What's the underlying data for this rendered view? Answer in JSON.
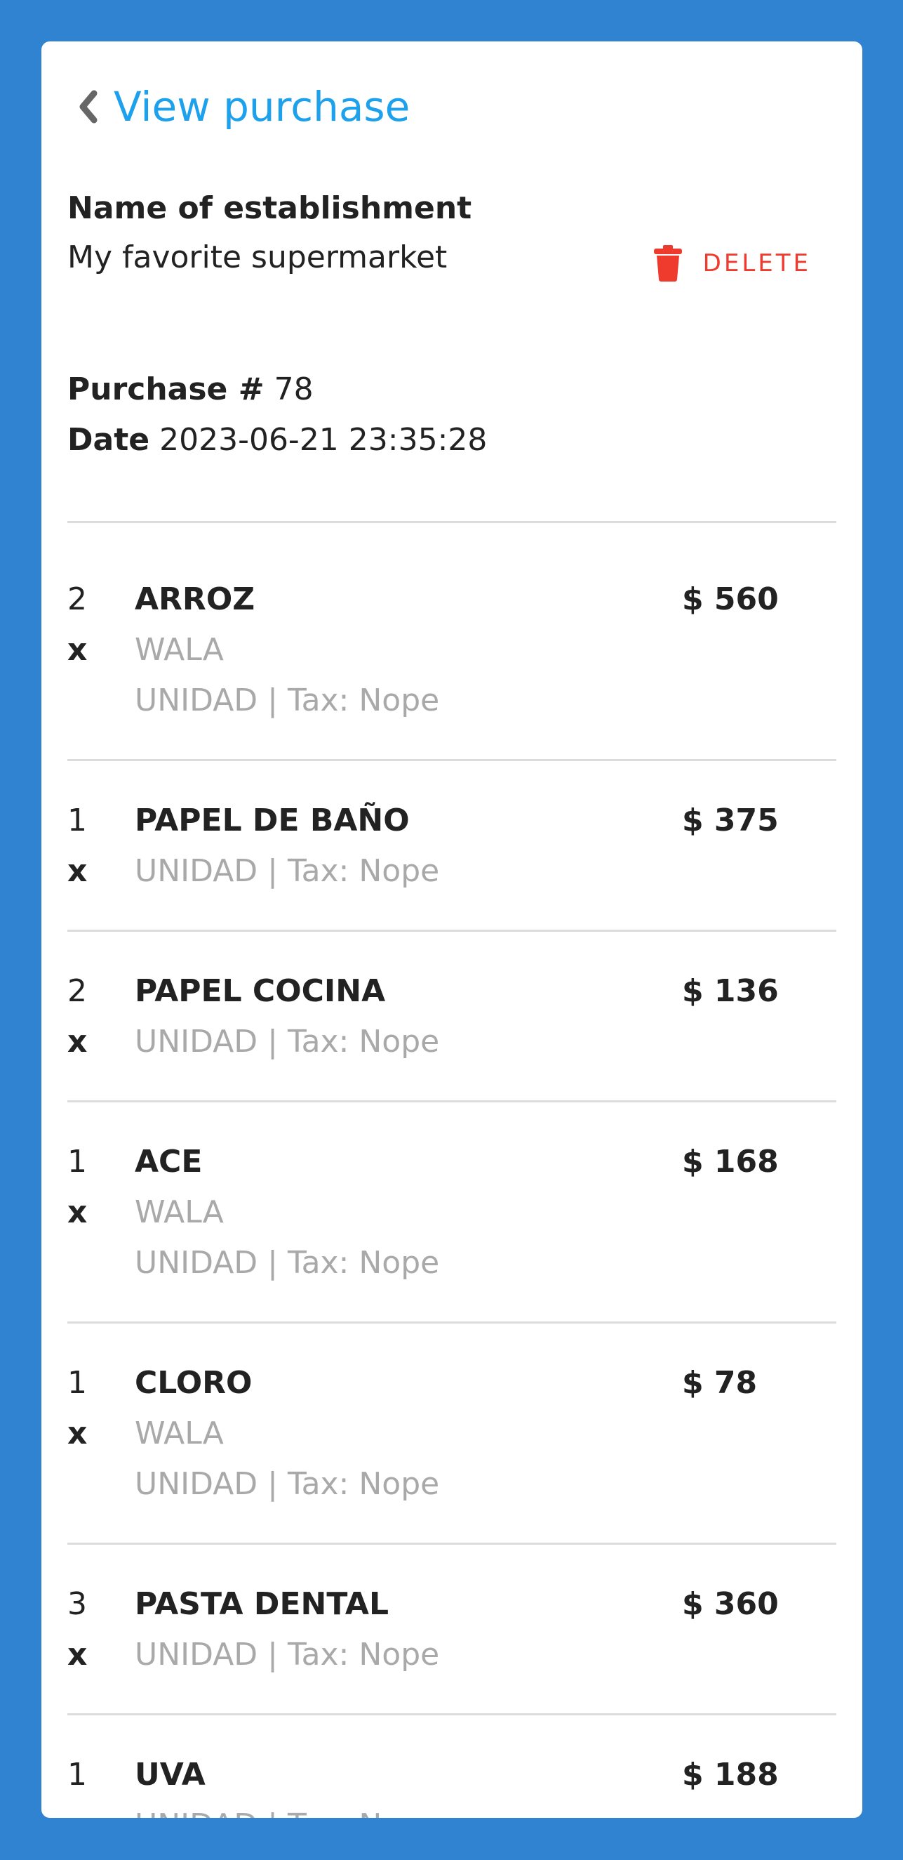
{
  "header": {
    "title": "View purchase"
  },
  "establishment": {
    "label": "Name of establishment",
    "value": "My favorite supermarket"
  },
  "actions": {
    "delete_label": "DELETE"
  },
  "purchase": {
    "number_label": "Purchase #",
    "number": "78",
    "date_label": "Date",
    "date": "2023-06-21 23:35:28"
  },
  "items": [
    {
      "qty": "2",
      "x": "x",
      "name": "ARROZ",
      "brand": "WALA",
      "detail": "UNIDAD | Tax: Nope",
      "price": "$ 560"
    },
    {
      "qty": "1",
      "x": "x",
      "name": "PAPEL DE BAÑO",
      "detail": "UNIDAD | Tax: Nope",
      "price": "$ 375"
    },
    {
      "qty": "2",
      "x": "x",
      "name": "PAPEL COCINA",
      "detail": "UNIDAD | Tax: Nope",
      "price": "$ 136"
    },
    {
      "qty": "1",
      "x": "x",
      "name": "ACE",
      "brand": "WALA",
      "detail": "UNIDAD | Tax: Nope",
      "price": "$ 168"
    },
    {
      "qty": "1",
      "x": "x",
      "name": "CLORO",
      "brand": "WALA",
      "detail": "UNIDAD | Tax: Nope",
      "price": "$ 78"
    },
    {
      "qty": "3",
      "x": "x",
      "name": "PASTA DENTAL",
      "detail": "UNIDAD | Tax: Nope",
      "price": "$ 360"
    },
    {
      "qty": "1",
      "x": "x",
      "name": "UVA",
      "detail": "UNIDAD | Tax: Nope",
      "price": "$ 188"
    }
  ],
  "colors": {
    "background": "#2f83d1",
    "accent": "#1da1ec",
    "delete": "#ef3b2d",
    "muted_text": "#a9a9a9"
  }
}
